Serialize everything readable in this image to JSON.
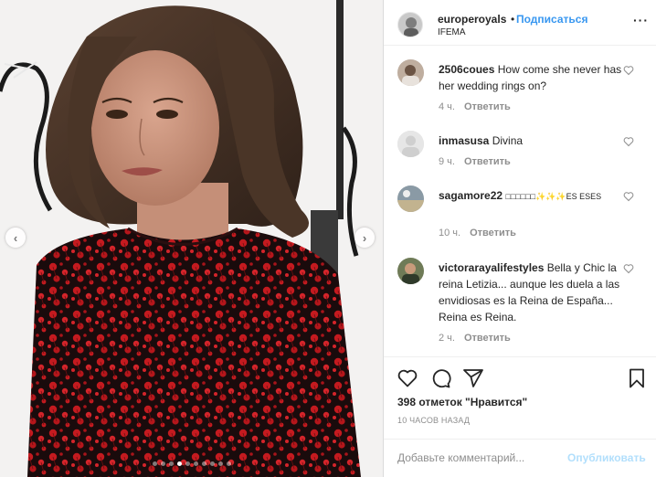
{
  "post": {
    "username": "europeroyals",
    "separator": "•",
    "follow_label": "Подписаться",
    "location": "IFEMA",
    "more_label": "···"
  },
  "carousel": {
    "prev_label": "‹",
    "next_label": "›",
    "dot_count": 10,
    "active_index": 3
  },
  "comments": [
    {
      "username": "2506coues",
      "text": "How come she never has her wedding rings on?",
      "time": "4 ч.",
      "reply_label": "Ответить"
    },
    {
      "username": "inmasusa",
      "text": "Divina",
      "time": "9 ч.",
      "reply_label": "Ответить"
    },
    {
      "username": "sagamore22",
      "text": "□□□□□□✨✨✨ES ESES",
      "time": "10 ч.",
      "reply_label": "Ответить"
    },
    {
      "username": "victorarayalifestyles",
      "text": "Bella y Chic la reina Letizia... aunque les duela a las envidiosas es la Reina de España... Reina es Reina.",
      "time": "2 ч.",
      "reply_label": "Ответить"
    }
  ],
  "actions": {
    "icons": [
      "heart-icon",
      "comment-icon",
      "share-icon",
      "bookmark-icon"
    ],
    "likes_text": "398 отметок \"Нравится\"",
    "time_ago": "10 ЧАСОВ НАЗАД"
  },
  "add_comment": {
    "placeholder": "Добавьте комментарий...",
    "publish_label": "Опубликовать"
  },
  "colors": {
    "link_blue": "#3897f0",
    "publish_disabled": "#b2dffc",
    "muted_text": "#8e8e8e",
    "border": "#efefef",
    "dress_red": "#c41a1f"
  }
}
